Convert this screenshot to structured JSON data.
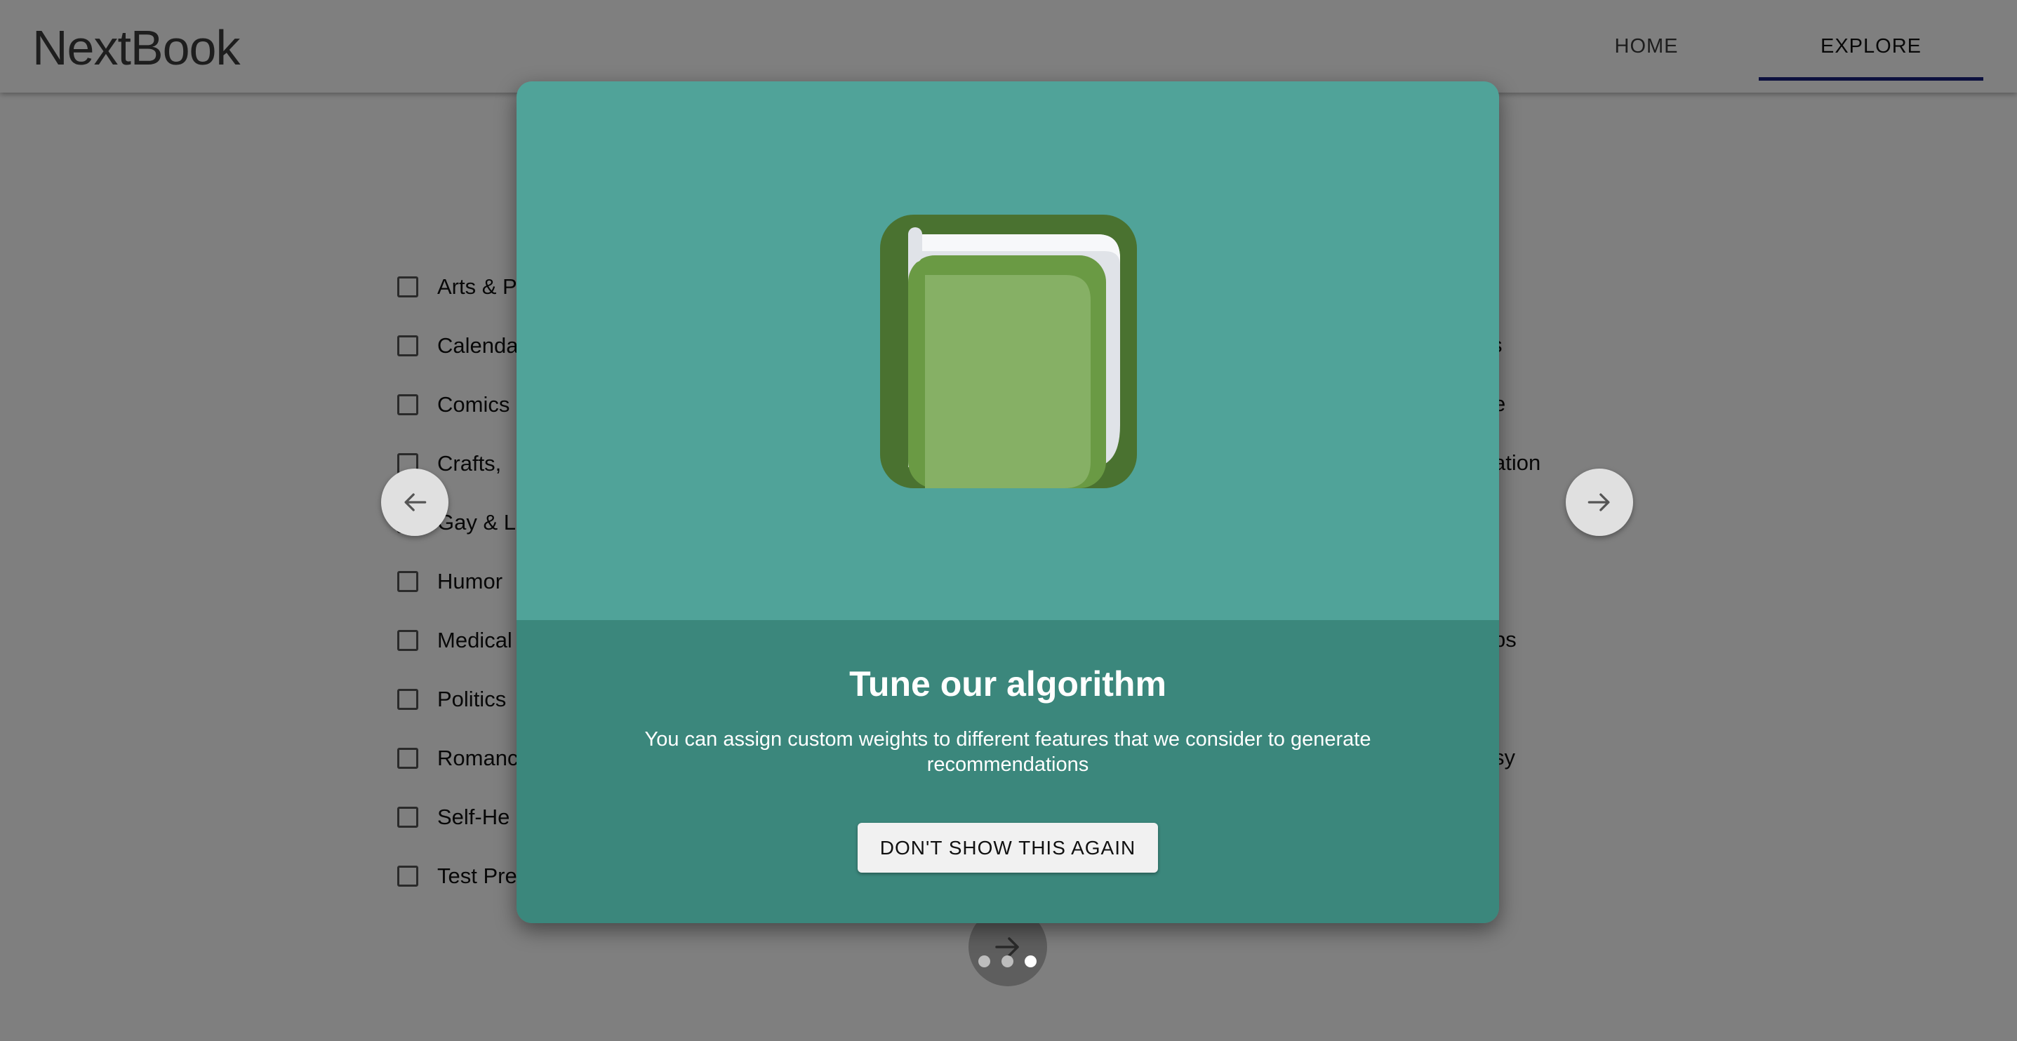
{
  "app": {
    "title": "NextBook"
  },
  "nav": {
    "home_label": "HOME",
    "explore_label": "EXPLORE",
    "active_tab": "EXPLORE"
  },
  "categories": {
    "left": [
      "Arts & P",
      "Calenda",
      "Comics",
      "Crafts,",
      "Gay & L",
      "Humor",
      "Medical",
      "Politics",
      "Romanc",
      "Self-He",
      "Test Pre"
    ],
    "right": [
      "s",
      "e",
      "ation",
      "ps",
      "sy"
    ]
  },
  "dialog": {
    "title": "Tune our algorithm",
    "text": "You can assign custom weights to different features that we consider to generate recommendations",
    "dismiss_label": "DON'T SHOW THIS AGAIN",
    "icon": "book-icon"
  },
  "pagination": {
    "total": 3,
    "active_index": 2
  },
  "colors": {
    "dialog_top": "#50a399",
    "dialog_bottom": "#3b877c",
    "tab_indicator": "#1a237e",
    "book_cover": "#4a7230",
    "book_face": "#86b065",
    "book_pages": "#e0e3e8"
  }
}
